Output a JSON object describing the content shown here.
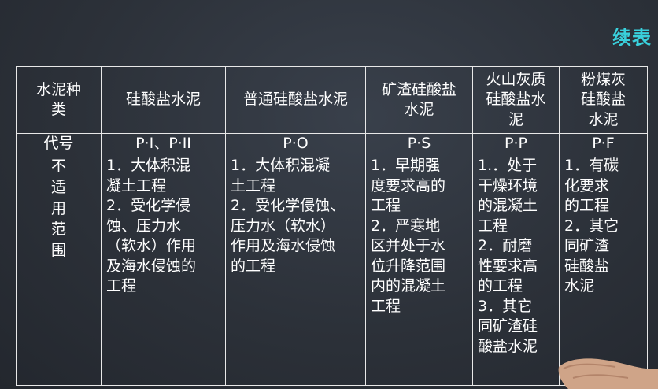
{
  "title": "续表",
  "table": {
    "header": {
      "row_label": [
        "水泥种",
        "类"
      ],
      "columns": [
        [
          "硅酸盐水泥"
        ],
        [
          "普通硅酸盐水泥"
        ],
        [
          "矿渣硅酸盐",
          "水泥"
        ],
        [
          "火山灰质",
          "硅酸盐水",
          "泥"
        ],
        [
          "粉煤灰",
          "硅酸盐",
          "水泥"
        ]
      ]
    },
    "code_row": {
      "label": "代号",
      "values": [
        "P·I、P·II",
        "P·O",
        "P·S",
        "P·P",
        "P·F"
      ]
    },
    "scope_row": {
      "label": [
        "不",
        "适",
        "用",
        "范",
        "围"
      ],
      "cells": [
        [
          "1．大体积混",
          "凝土工程",
          "2．受化学侵",
          "蚀、压力水",
          "（软水）作用",
          "及海水侵蚀的",
          "工程"
        ],
        [
          "1．大体积混凝",
          "土工程",
          "2．受化学侵蚀、",
          "压力水（软水）",
          "作用及海水侵蚀",
          "的工程"
        ],
        [
          "1．早期强",
          "度要求高的",
          "工程",
          "2．严寒地",
          "区并处于水",
          "位升降范围",
          "内的混凝土",
          "工程"
        ],
        [
          "1.．处于",
          "干燥环境",
          "的混凝土",
          "工程",
          "2．耐磨",
          "性要求高",
          "的工程",
          "3．其它",
          "同矿渣硅",
          "酸盐水泥"
        ],
        [
          "1．有碳",
          "化要求",
          "的工程",
          "2．其它",
          "同矿渣",
          "硅酸盐",
          "水泥"
        ]
      ]
    }
  }
}
